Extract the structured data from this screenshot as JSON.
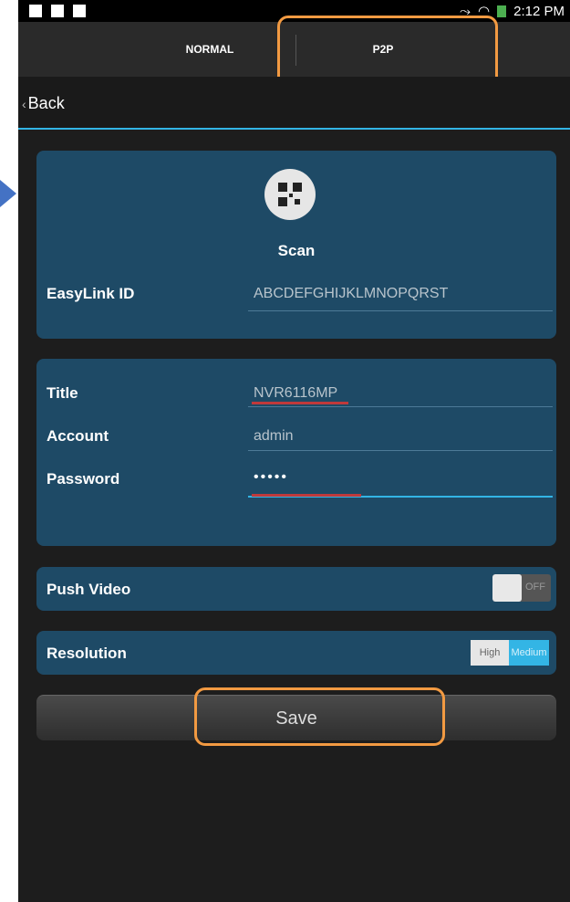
{
  "statusbar": {
    "time": "2:12 PM"
  },
  "tabs": {
    "normal": "NORMAL",
    "p2p": "P2P"
  },
  "nav": {
    "back": "Back"
  },
  "device": {
    "scan_label": "Scan",
    "easylink_label": "EasyLink ID",
    "easylink_value": "ABCDEFGHIJKLMNOPQRST"
  },
  "credentials": {
    "title_label": "Title",
    "title_value": "NVR6116MP",
    "account_label": "Account",
    "account_value": "admin",
    "password_label": "Password",
    "password_value": "•••••"
  },
  "push_video": {
    "label": "Push Video",
    "state": "OFF"
  },
  "resolution": {
    "label": "Resolution",
    "options": [
      "High",
      "Medium"
    ],
    "selected": "Medium"
  },
  "save": {
    "label": "Save"
  },
  "colors": {
    "accent": "#33b5e5",
    "panel": "#1e4a66",
    "highlight": "#f29a42",
    "underline": "#c0393b",
    "arrow": "#4472c4"
  }
}
